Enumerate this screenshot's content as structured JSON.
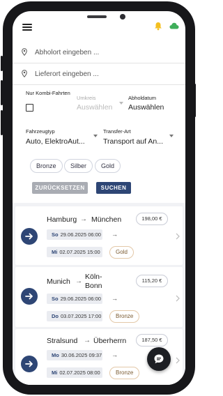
{
  "search": {
    "pickup_placeholder": "Abholort eingeben ...",
    "delivery_placeholder": "Lieferort eingeben ..."
  },
  "filters": {
    "kombi_label": "Nur Kombi-Fahrten",
    "kombi_checked": false,
    "umkreis_label": "Umkreis",
    "umkreis_value": "Auswählen",
    "abholdatum_label": "Abholdatum",
    "abholdatum_value": "Auswählen",
    "fahrzeugtyp_label": "Fahrzeugtyp",
    "fahrzeugtyp_value": "Auto, ElektroAut...",
    "transferart_label": "Transfer-Art",
    "transferart_value": "Transport auf An..."
  },
  "tiers": [
    "Bronze",
    "Silber",
    "Gold"
  ],
  "actions": {
    "reset_label": "ZURÜCKSETZEN",
    "search_label": "SUCHEN"
  },
  "results": [
    {
      "from": "Hamburg",
      "arrow": "→",
      "to": "München",
      "price": "198,00 €",
      "pickup_day": "So",
      "pickup_date": "29.06.2025 06:00",
      "delivery_day": "Mi",
      "delivery_date": "02.07.2025 15:00",
      "tier": "Gold"
    },
    {
      "from": "Munich",
      "arrow": "→",
      "to_line1": "Köln-",
      "to_line2": "Bonn",
      "price": "115,20 €",
      "pickup_day": "So",
      "pickup_date": "29.06.2025 06:00",
      "delivery_day": "Do",
      "delivery_date": "03.07.2025 17:00",
      "tier": "Bronze"
    },
    {
      "from": "Stralsund",
      "arrow": "→",
      "to": "Überherrn",
      "price": "187,50 €",
      "pickup_day": "Mo",
      "pickup_date": "30.06.2025 09:37",
      "delivery_day": "Mi",
      "delivery_date": "02.07.2025 08:00",
      "tier": "Bronze"
    }
  ],
  "colors": {
    "primary": "#2e4675",
    "bell": "#f4c020",
    "cloud": "#3fae5a",
    "reset": "#a9acb3"
  },
  "icons": {
    "menu": "hamburger-menu-icon",
    "bell": "bell-icon",
    "cloud": "cloud-icon",
    "pin": "location-pin-icon",
    "go": "arrow-right-icon",
    "chat": "chat-icon"
  }
}
